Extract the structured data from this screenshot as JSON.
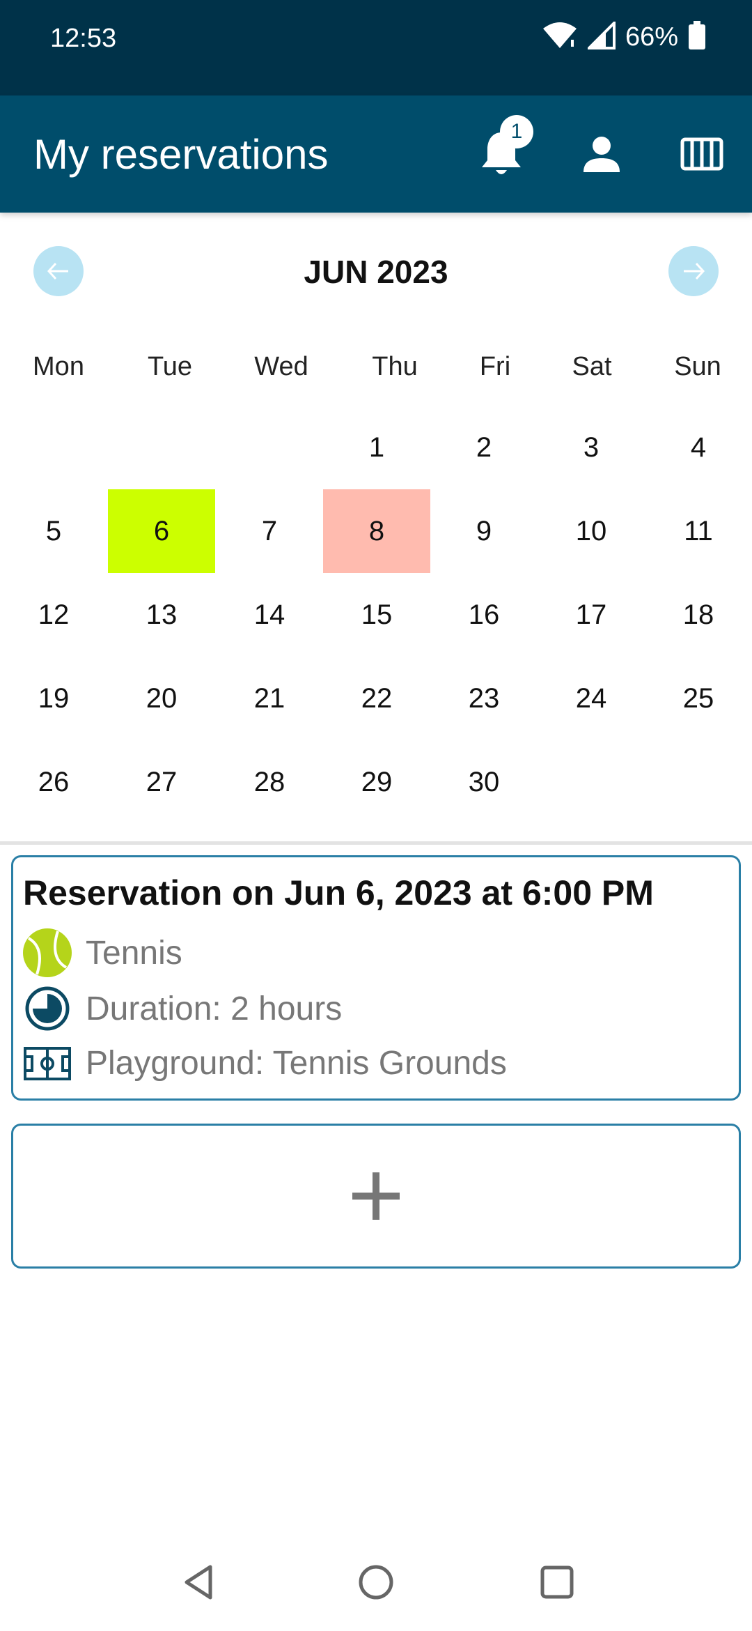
{
  "status_bar": {
    "time": "12:53",
    "battery_pct": "66%"
  },
  "app_bar": {
    "title": "My reservations",
    "notification_count": "1"
  },
  "calendar": {
    "month_label": "JUN 2023",
    "weekdays": [
      "Mon",
      "Tue",
      "Wed",
      "Thu",
      "Fri",
      "Sat",
      "Sun"
    ],
    "weeks": [
      [
        "",
        "",
        "",
        "1",
        "2",
        "3",
        "4"
      ],
      [
        "5",
        "6",
        "7",
        "8",
        "9",
        "10",
        "11"
      ],
      [
        "12",
        "13",
        "14",
        "15",
        "16",
        "17",
        "18"
      ],
      [
        "19",
        "20",
        "21",
        "22",
        "23",
        "24",
        "25"
      ],
      [
        "26",
        "27",
        "28",
        "29",
        "30",
        "",
        ""
      ]
    ],
    "highlighted_days": [
      {
        "day": "6",
        "color": "#ccff00"
      },
      {
        "day": "8",
        "color": "#ffbbaf"
      }
    ],
    "nav_button_color": "#b8e3f3"
  },
  "reservation": {
    "title": "Reservation on Jun 6, 2023 at 6:00 PM",
    "sport": "Tennis",
    "duration": "Duration: 2 hours",
    "playground": "Playground: Tennis Grounds"
  },
  "colors": {
    "status_bar": "#003249",
    "app_bar": "#004d6b",
    "card_border": "#2a7fa6"
  }
}
